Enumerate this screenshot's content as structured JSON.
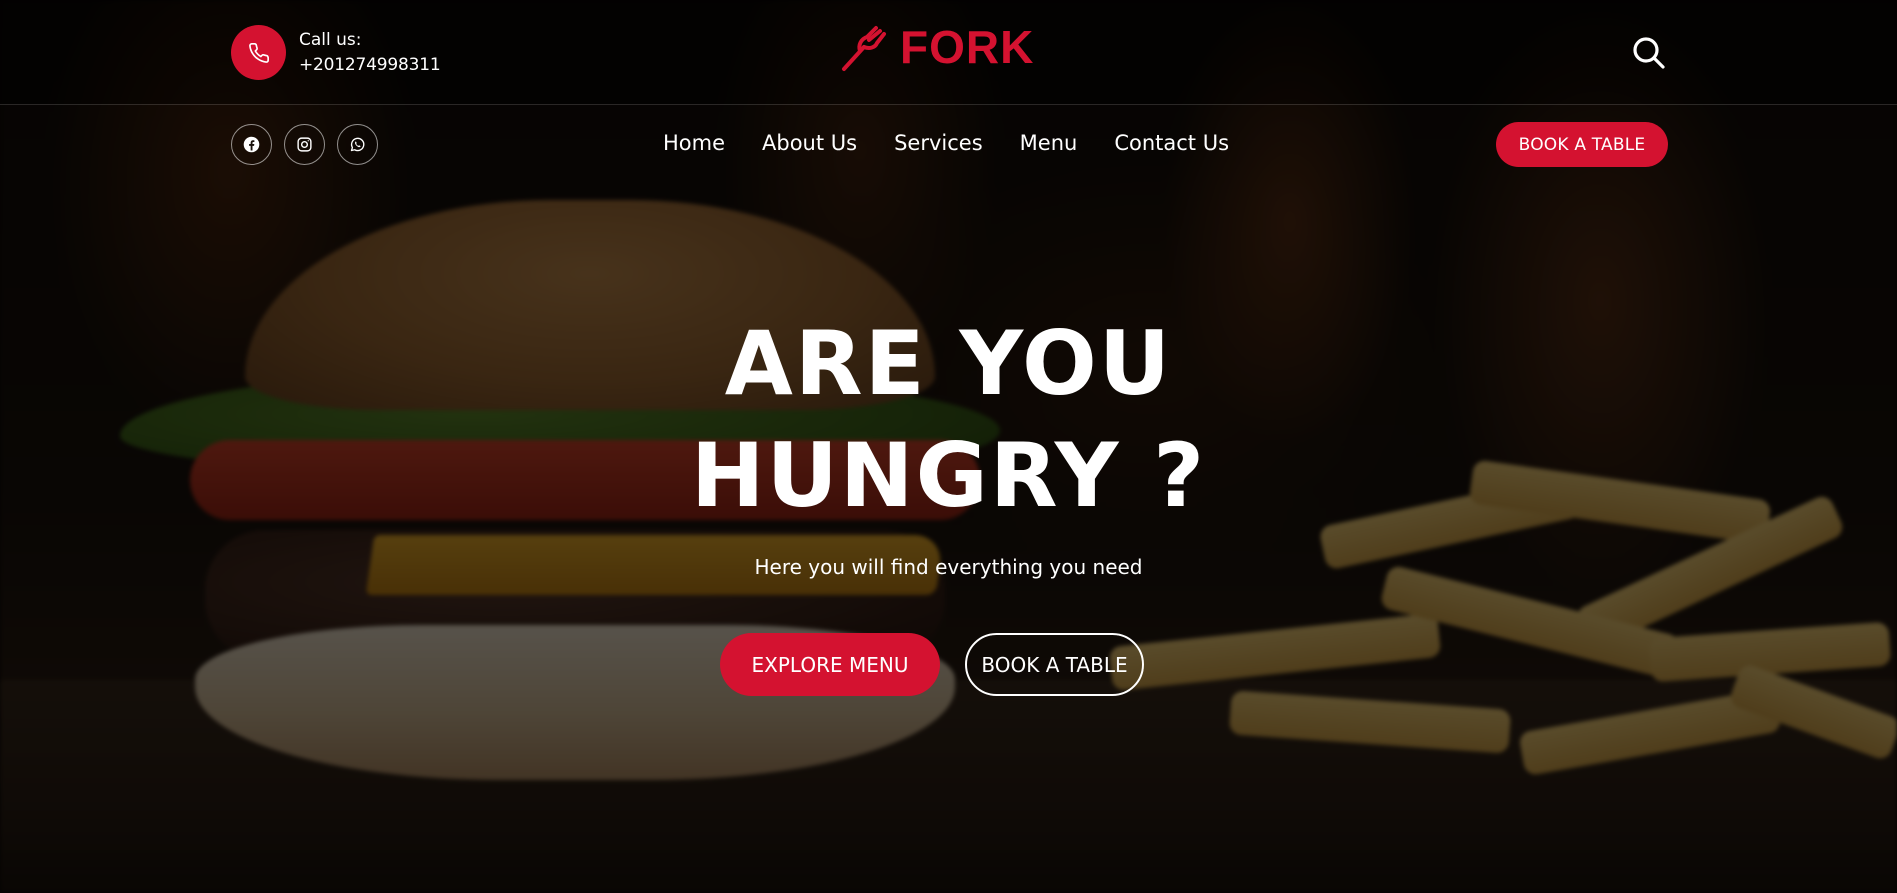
{
  "brand": {
    "name": "FORK",
    "accent_color": "#d41230",
    "logo_icon": "fork-icon"
  },
  "contact": {
    "label": "Call us:",
    "phone": "+201274998311",
    "icon": "phone-icon"
  },
  "header": {
    "search_icon": "search-icon"
  },
  "socials": [
    {
      "icon": "facebook-icon"
    },
    {
      "icon": "instagram-icon"
    },
    {
      "icon": "whatsapp-icon"
    }
  ],
  "nav": {
    "items": [
      {
        "label": "Home"
      },
      {
        "label": "About Us"
      },
      {
        "label": "Services"
      },
      {
        "label": "Menu"
      },
      {
        "label": "Contact Us"
      }
    ],
    "book_label": "BOOK A TABLE"
  },
  "hero": {
    "title_line1": "ARE YOU",
    "title_line2": "HUNGRY ?",
    "subtitle": "Here you will find everything you need",
    "primary_cta": "EXPLORE MENU",
    "secondary_cta": "BOOK A TABLE"
  }
}
